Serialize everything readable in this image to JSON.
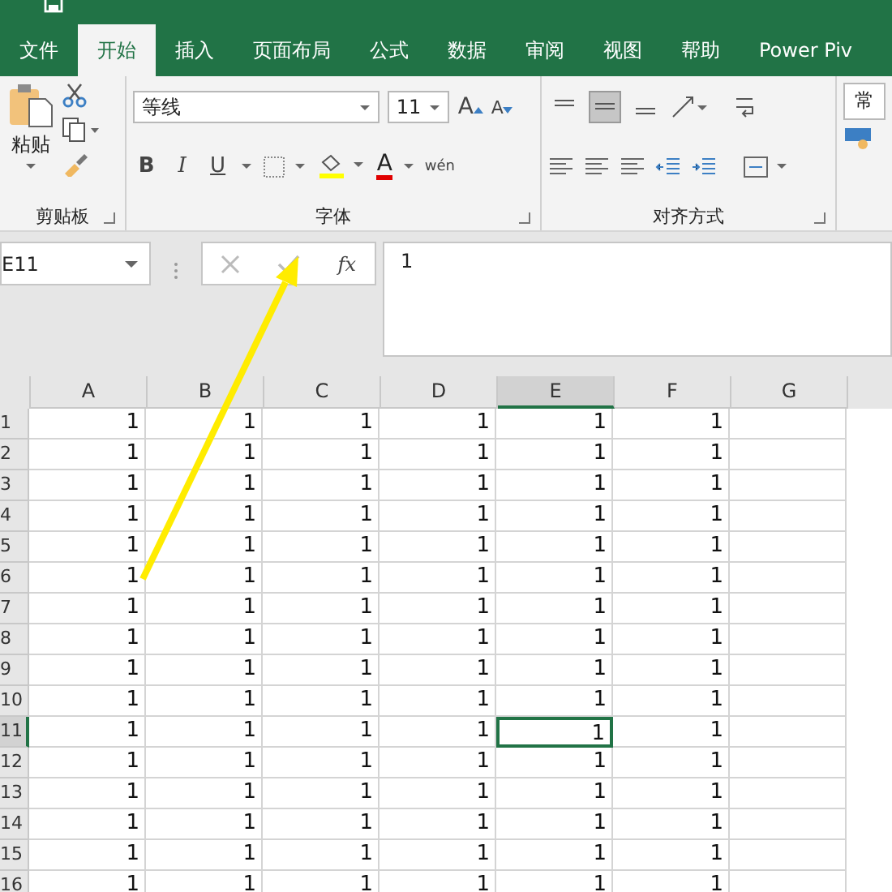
{
  "ribbon_tabs": [
    {
      "label": "文件",
      "selected": false
    },
    {
      "label": "开始",
      "selected": true
    },
    {
      "label": "插入",
      "selected": false
    },
    {
      "label": "页面布局",
      "selected": false
    },
    {
      "label": "公式",
      "selected": false
    },
    {
      "label": "数据",
      "selected": false
    },
    {
      "label": "审阅",
      "selected": false
    },
    {
      "label": "视图",
      "selected": false
    },
    {
      "label": "帮助",
      "selected": false
    },
    {
      "label": "Power Piv",
      "selected": false
    }
  ],
  "clipboard_group": {
    "paste": "粘贴",
    "label": "剪贴板"
  },
  "font_group": {
    "font_name": "等线",
    "font_size": "11",
    "grow": "A",
    "shrink": "A",
    "bold": "B",
    "italic": "I",
    "underline": "U",
    "font_color": "A",
    "phonetic": "wén",
    "label": "字体"
  },
  "alignment_group": {
    "vertical": [
      {
        "selected": false
      },
      {
        "selected": true
      },
      {
        "selected": false
      }
    ],
    "label": "对齐方式"
  },
  "number_group": {
    "format": "常"
  },
  "formula_bar": {
    "name_box": "E11",
    "fx": "fx",
    "formula": "1"
  },
  "columns": [
    {
      "label": "A",
      "selected": false
    },
    {
      "label": "B",
      "selected": false
    },
    {
      "label": "C",
      "selected": false
    },
    {
      "label": "D",
      "selected": false
    },
    {
      "label": "E",
      "selected": true
    },
    {
      "label": "F",
      "selected": false
    },
    {
      "label": "G",
      "selected": false
    }
  ],
  "rows": [
    {
      "header": "1",
      "selected": false,
      "cells": [
        "1",
        "1",
        "1",
        "1",
        "1",
        "1"
      ]
    },
    {
      "header": "2",
      "selected": false,
      "cells": [
        "1",
        "1",
        "1",
        "1",
        "1",
        "1"
      ]
    },
    {
      "header": "3",
      "selected": false,
      "cells": [
        "1",
        "1",
        "1",
        "1",
        "1",
        "1"
      ]
    },
    {
      "header": "4",
      "selected": false,
      "cells": [
        "1",
        "1",
        "1",
        "1",
        "1",
        "1"
      ]
    },
    {
      "header": "5",
      "selected": false,
      "cells": [
        "1",
        "1",
        "1",
        "1",
        "1",
        "1"
      ]
    },
    {
      "header": "6",
      "selected": false,
      "cells": [
        "1",
        "1",
        "1",
        "1",
        "1",
        "1"
      ]
    },
    {
      "header": "7",
      "selected": false,
      "cells": [
        "1",
        "1",
        "1",
        "1",
        "1",
        "1"
      ]
    },
    {
      "header": "8",
      "selected": false,
      "cells": [
        "1",
        "1",
        "1",
        "1",
        "1",
        "1"
      ]
    },
    {
      "header": "9",
      "selected": false,
      "cells": [
        "1",
        "1",
        "1",
        "1",
        "1",
        "1"
      ]
    },
    {
      "header": "10",
      "selected": false,
      "cells": [
        "1",
        "1",
        "1",
        "1",
        "1",
        "1"
      ]
    },
    {
      "header": "11",
      "selected": true,
      "cells": [
        "1",
        "1",
        "1",
        "1",
        "1",
        "1"
      ]
    },
    {
      "header": "12",
      "selected": false,
      "cells": [
        "1",
        "1",
        "1",
        "1",
        "1",
        "1"
      ]
    },
    {
      "header": "13",
      "selected": false,
      "cells": [
        "1",
        "1",
        "1",
        "1",
        "1",
        "1"
      ]
    },
    {
      "header": "14",
      "selected": false,
      "cells": [
        "1",
        "1",
        "1",
        "1",
        "1",
        "1"
      ]
    },
    {
      "header": "15",
      "selected": false,
      "cells": [
        "1",
        "1",
        "1",
        "1",
        "1",
        "1"
      ]
    },
    {
      "header": "16",
      "selected": false,
      "cells": [
        "1",
        "1",
        "1",
        "1",
        "1",
        "1"
      ]
    }
  ]
}
